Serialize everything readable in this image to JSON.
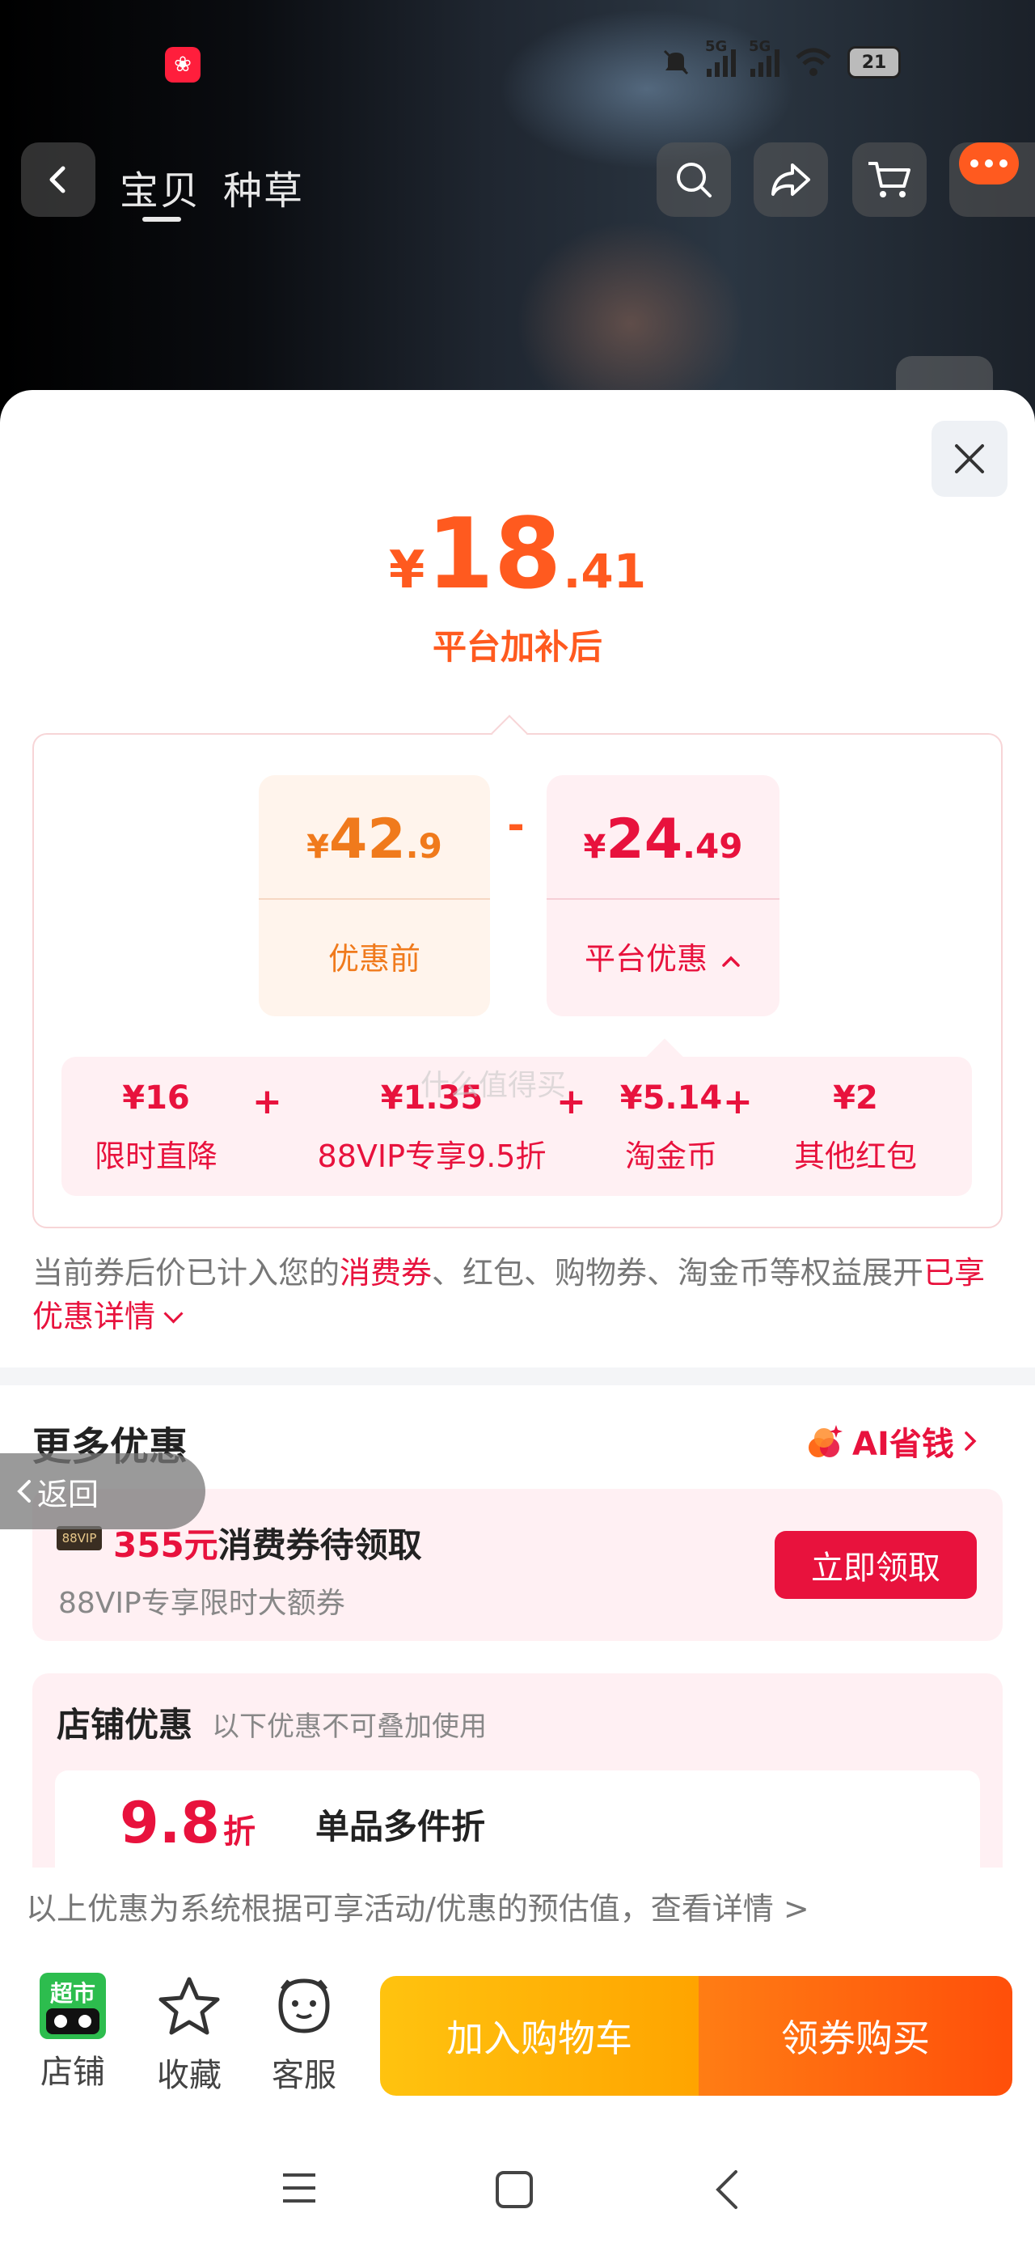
{
  "status_bar": {
    "network_1": "5G",
    "network_2": "5G",
    "battery": "21"
  },
  "header": {
    "tabs": [
      {
        "label": "宝贝",
        "active": true
      },
      {
        "label": "种草",
        "active": false
      }
    ],
    "icons": [
      "back-icon",
      "search-icon",
      "share-icon",
      "cart-icon",
      "message-icon"
    ]
  },
  "price": {
    "currency": "¥",
    "integer": "18",
    "decimal": ".41",
    "label": "平台加补后"
  },
  "calc": {
    "before": {
      "currency": "¥",
      "integer": "42",
      "decimal": ".9",
      "label": "优惠前"
    },
    "operator": "-",
    "platform": {
      "currency": "¥",
      "integer": "24",
      "decimal": ".49",
      "label": "平台优惠"
    },
    "breakdown": [
      {
        "amount": "¥16",
        "label": "限时直降"
      },
      {
        "amount": "¥1.35",
        "label": "88VIP专享9.5折"
      },
      {
        "amount": "¥5.14",
        "label": "淘金币"
      },
      {
        "amount": "¥2",
        "label": "其他红包"
      }
    ],
    "plus": "+",
    "watermark": "什么值得买"
  },
  "note": {
    "part1": "当前券后价已计入您的",
    "highlight1": "消费券",
    "part2": "、红包、购物券、淘金币等权益展开",
    "highlight2": "已享优惠详情"
  },
  "more": {
    "title": "更多优惠",
    "ai_label": "AI省钱",
    "back_label": "返回"
  },
  "vip_coupon": {
    "tag": "88VIP",
    "amount": "355元",
    "title": "消费券待领取",
    "subtitle": "88VIP专享限时大额券",
    "button": "立即领取"
  },
  "shop_discount": {
    "title": "店铺优惠",
    "subtitle": "以下优惠不可叠加使用",
    "discount_value": "9.8",
    "discount_unit": "折",
    "discount_name": "单品多件折"
  },
  "estimate_note": "以上优惠为系统根据可享活动/优惠的预估值，查看详情 >",
  "bottom_bar": {
    "shop_label": "店铺",
    "shop_badge": "超市",
    "fav_label": "收藏",
    "service_label": "客服",
    "cart_button": "加入购物车",
    "buy_button": "领券购买"
  },
  "colors": {
    "accent_orange": "#ff5a1f",
    "accent_red": "#e8123d",
    "cart_yellow": "#ffb000",
    "buy_orange": "#ff5a0f"
  }
}
